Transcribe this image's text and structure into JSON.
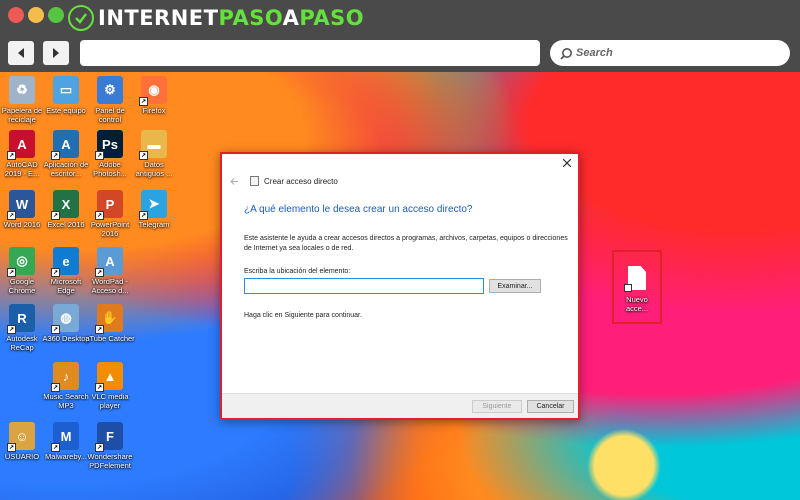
{
  "header": {
    "logo": {
      "part1": "INTERNET",
      "part2": "PASO",
      "part3": "A",
      "part4": "PASO"
    },
    "search_placeholder": "Search"
  },
  "desktop_icons": [
    {
      "label": "Papelera de reciclaje",
      "color": "#9fb4c8",
      "icon": "recycle-bin-icon"
    },
    {
      "label": "Este equipo",
      "color": "#4fa3e0",
      "icon": "computer-icon"
    },
    {
      "label": "Panel de control",
      "color": "#3a7bd5",
      "icon": "control-panel-icon"
    },
    {
      "label": "Firefox",
      "color": "#ff7139",
      "icon": "firefox-icon"
    },
    {
      "label": "AutoCAD 2019 - E...",
      "color": "#c8102e",
      "icon": "autocad-icon"
    },
    {
      "label": "Aplicación de escritor...",
      "color": "#1f6fb2",
      "icon": "autodesk-app-icon"
    },
    {
      "label": "Adobe Photosh...",
      "color": "#001e36",
      "icon": "photoshop-icon"
    },
    {
      "label": "Datos antiguos ...",
      "color": "#e8b84a",
      "icon": "folder-icon"
    },
    {
      "label": "Word 2016",
      "color": "#2b579a",
      "icon": "word-icon"
    },
    {
      "label": "Excel 2016",
      "color": "#217346",
      "icon": "excel-icon"
    },
    {
      "label": "PowerPoint 2016",
      "color": "#d24726",
      "icon": "powerpoint-icon"
    },
    {
      "label": "Telegram",
      "color": "#2aa3e0",
      "icon": "telegram-icon"
    },
    {
      "label": "Google Chrome",
      "color": "#34a853",
      "icon": "chrome-icon"
    },
    {
      "label": "Microsoft Edge",
      "color": "#0f7bd1",
      "icon": "edge-icon"
    },
    {
      "label": "WordPad - Acceso d...",
      "color": "#5b9bd5",
      "icon": "wordpad-icon"
    },
    {
      "label": "Autodesk ReCap",
      "color": "#1b5fa8",
      "icon": "recap-icon"
    },
    {
      "label": "A360 Desktop",
      "color": "#7aa9d6",
      "icon": "a360-icon"
    },
    {
      "label": "aTube Catcher",
      "color": "#e07a1f",
      "icon": "atube-icon"
    },
    {
      "label": "Music Search MP3",
      "color": "#e08a1f",
      "icon": "music-search-icon"
    },
    {
      "label": "VLC media player",
      "color": "#f28c00",
      "icon": "vlc-icon"
    },
    {
      "label": "USUARIO",
      "color": "#d9a441",
      "icon": "user-folder-icon"
    },
    {
      "label": "Malwareby...",
      "color": "#1d5fd1",
      "icon": "malwarebytes-icon"
    },
    {
      "label": "Wondershare PDFelement",
      "color": "#1d4fa8",
      "icon": "pdfelement-icon"
    }
  ],
  "new_shortcut": {
    "label": "Nuevo acce..."
  },
  "dialog": {
    "title": "Crear acceso directo",
    "heading": "¿A qué elemento le desea crear un acceso directo?",
    "description": "Este asistente le ayuda a crear accesos directos a programas, archivos, carpetas, equipos o direcciones de Internet ya sea locales o de red.",
    "field_label": "Escriba la ubicación del elemento:",
    "field_value": "",
    "browse_label": "Examinar...",
    "hint": "Haga clic en Siguiente para continuar.",
    "next_label": "Siguiente",
    "cancel_label": "Cancelar"
  }
}
